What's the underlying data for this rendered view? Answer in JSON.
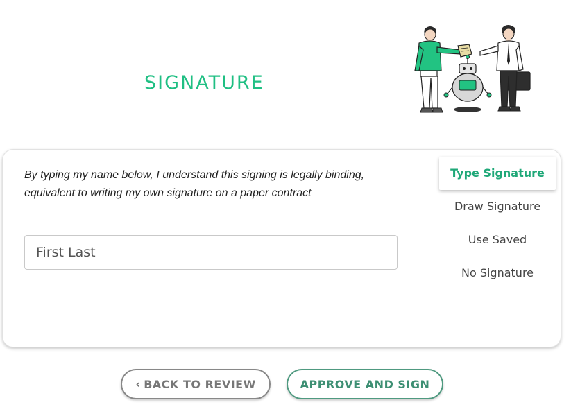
{
  "header": {
    "title": "SIGNATURE"
  },
  "signature_panel": {
    "disclaimer": "By typing my name below, I understand this signing is legally binding, equivalent to writing my own signature on a paper contract",
    "name_input": {
      "value": "",
      "placeholder": "First Last"
    },
    "options": [
      {
        "label": "Type Signature",
        "active": true
      },
      {
        "label": "Draw Signature",
        "active": false
      },
      {
        "label": "Use Saved",
        "active": false
      },
      {
        "label": "No Signature",
        "active": false
      }
    ]
  },
  "actions": {
    "back_label": "BACK TO REVIEW",
    "approve_label": "APPROVE AND SIGN"
  },
  "colors": {
    "accent": "#1fbf83",
    "approve_border": "#4f9a80",
    "back_border": "#888888"
  },
  "icons": {
    "back": "chevron-left-icon",
    "illustration": "handshake-robot-illustration"
  }
}
